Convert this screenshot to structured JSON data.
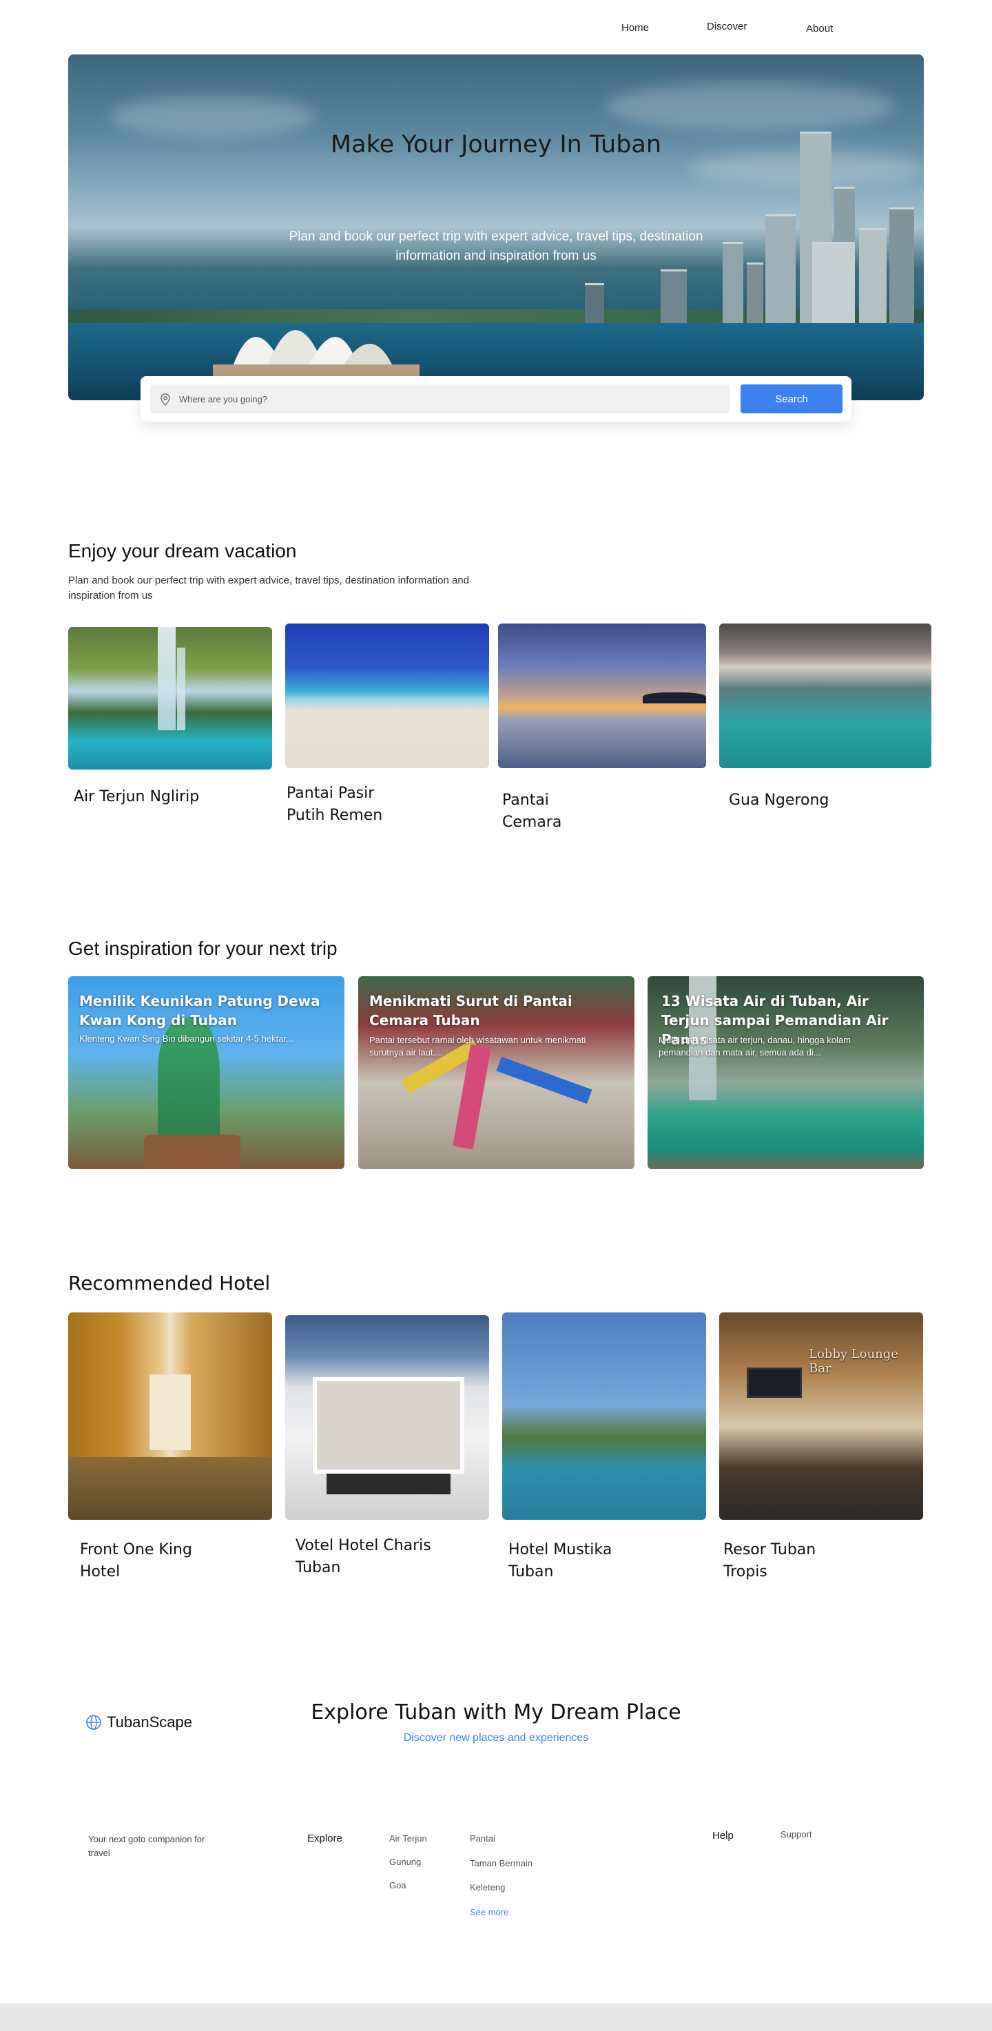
{
  "nav": {
    "home": "Home",
    "discover": "Discover",
    "about": "About"
  },
  "hero": {
    "title": "Make Your Journey In Tuban",
    "subtitle": "Plan and book our perfect trip with expert advice, travel tips, destination information and  inspiration from us"
  },
  "search": {
    "placeholder": "Where are you going?",
    "button": "Search"
  },
  "dream": {
    "heading": "Enjoy your dream vacation",
    "description": "Plan and book our perfect trip with expert advice, travel tips, destination information and inspiration from us",
    "cards": [
      {
        "title": "Air Terjun Nglirip"
      },
      {
        "title": "Pantai Pasir Putih Remen"
      },
      {
        "title": "Pantai Cemara"
      },
      {
        "title": "Gua Ngerong"
      }
    ]
  },
  "inspiration": {
    "heading": "Get inspiration for your next trip",
    "cards": [
      {
        "title": "Menilik Keunikan Patung Dewa Kwan Kong di Tuban",
        "summary": "Klenteng Kwan Sing Bio dibangun sekitar 4-5 hektar..."
      },
      {
        "title": "Menikmati Surut di Pantai Cemara Tuban",
        "summary": "Pantai tersebut ramai oleh wisatawan untuk menikmati\nsurutnya air laut...."
      },
      {
        "title": "13 Wisata Air di Tuban, Air Terjun sampai Pemandian Air Panas",
        "summary": "Mulai dari wisata air terjun, danau, hingga kolam\npemandian dan mata air, semua ada di..."
      }
    ]
  },
  "hotels": {
    "heading": "Recommended Hotel",
    "cards": [
      {
        "title": "Front One King Hotel"
      },
      {
        "title": "Votel Hotel Charis Tuban"
      },
      {
        "title": "Hotel Mustika Tuban"
      },
      {
        "title": "Resor Tuban Tropis"
      }
    ],
    "bar_sign": "Lobby Lounge Bar"
  },
  "footer": {
    "brand": "TubanScape",
    "cta_title": "Explore Tuban with My Dream Place",
    "cta_subtitle": "Discover new places and experiences",
    "tagline": "Your next goto companion for travel",
    "explore_heading": "Explore",
    "col1": [
      "Air Terjun",
      "Gunung",
      "Goa"
    ],
    "col2": [
      "Pantai",
      "Taman Bermain",
      "Keleteng"
    ],
    "see_more": "See more",
    "help_heading": "Help",
    "support": "Support"
  },
  "colors": {
    "accent": "#3b82f0"
  }
}
